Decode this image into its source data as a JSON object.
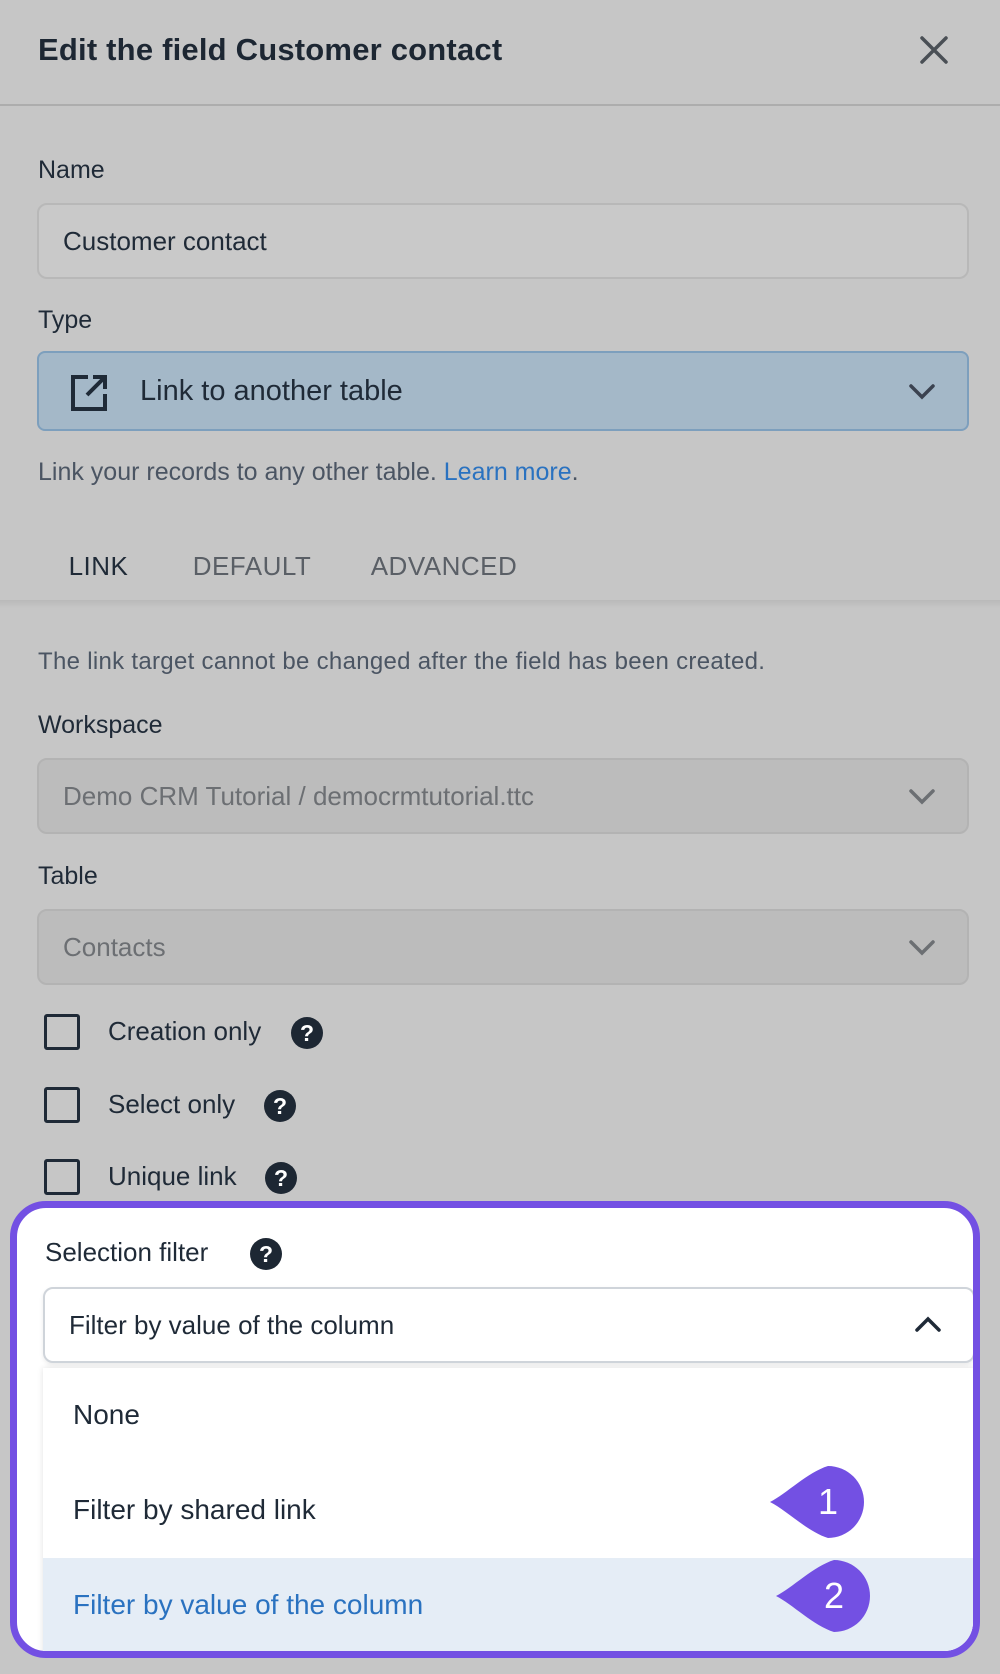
{
  "header": {
    "title": "Edit the field Customer contact",
    "close_icon": "close-icon"
  },
  "name": {
    "label": "Name",
    "value": "Customer contact"
  },
  "type": {
    "label": "Type",
    "value": "Link to another table",
    "icon": "external-link-icon"
  },
  "hint": {
    "text": "Link your records to any other table. ",
    "link": "Learn more",
    "suffix": "."
  },
  "tabs": [
    {
      "label": "LINK",
      "active": true
    },
    {
      "label": "DEFAULT",
      "active": false
    },
    {
      "label": "ADVANCED",
      "active": false
    }
  ],
  "note": "The link target cannot be changed after the field has been created.",
  "workspace": {
    "label": "Workspace",
    "value": "Demo CRM Tutorial / democrmtutorial.ttc"
  },
  "table": {
    "label": "Table",
    "value": "Contacts"
  },
  "checkboxes": [
    {
      "label": "Creation only",
      "checked": false
    },
    {
      "label": "Select only",
      "checked": false
    },
    {
      "label": "Unique link",
      "checked": false
    }
  ],
  "selection_filter": {
    "label": "Selection filter",
    "value": "Filter by value of the column",
    "options": [
      "None",
      "Filter by shared link",
      "Filter by value of the column"
    ],
    "selected_index": 2
  },
  "badges": [
    "1",
    "2"
  ],
  "colors": {
    "accent": "#2a72c0",
    "highlight": "#7350e3"
  }
}
